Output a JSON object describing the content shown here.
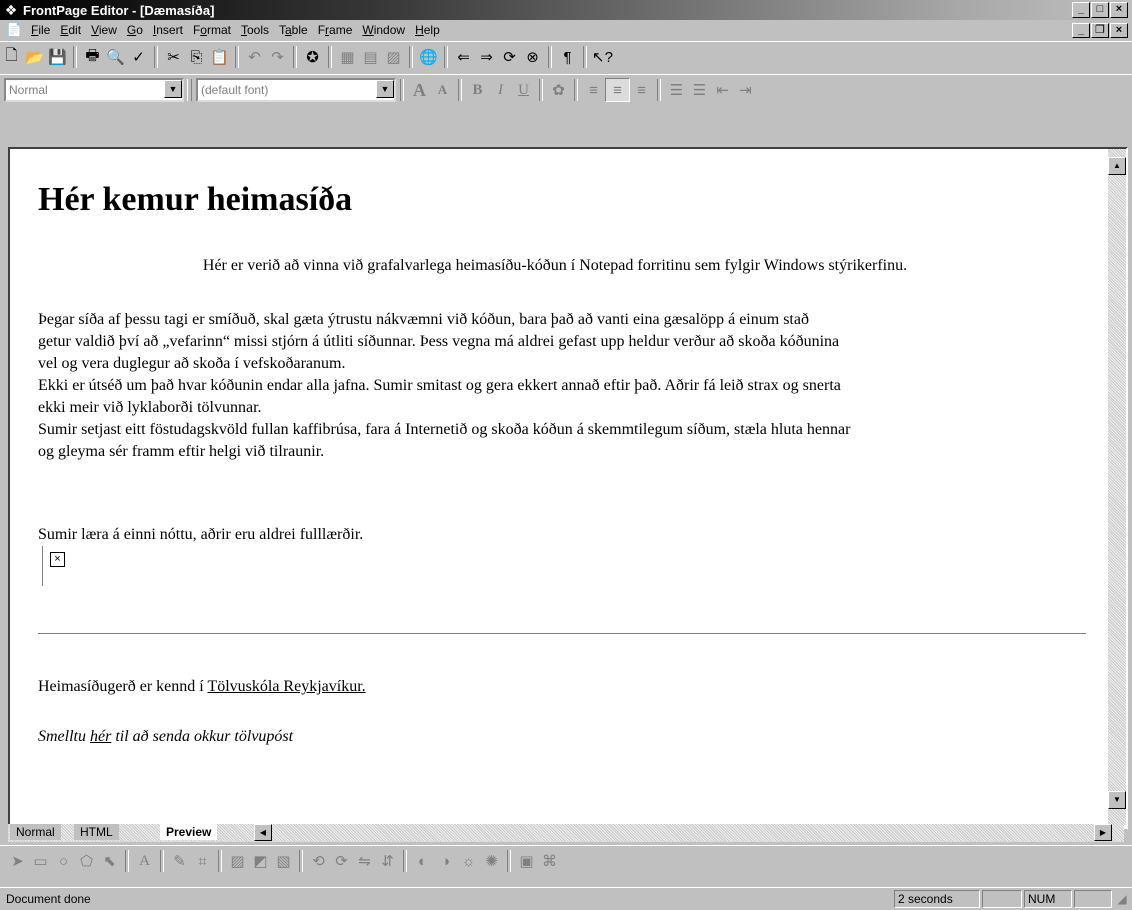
{
  "window": {
    "title": "FrontPage Editor - [Dæmasíða]",
    "controls": {
      "minimize": "_",
      "maximize": "□",
      "close": "×"
    }
  },
  "menu": {
    "items": [
      {
        "pre": "",
        "ul": "F",
        "post": "ile"
      },
      {
        "pre": "",
        "ul": "E",
        "post": "dit"
      },
      {
        "pre": "",
        "ul": "V",
        "post": "iew"
      },
      {
        "pre": "",
        "ul": "G",
        "post": "o"
      },
      {
        "pre": "",
        "ul": "I",
        "post": "nsert"
      },
      {
        "pre": "F",
        "ul": "o",
        "post": "rmat"
      },
      {
        "pre": "",
        "ul": "T",
        "post": "ools"
      },
      {
        "pre": "T",
        "ul": "a",
        "post": "ble"
      },
      {
        "pre": "F",
        "ul": "r",
        "post": "ame"
      },
      {
        "pre": "",
        "ul": "W",
        "post": "indow"
      },
      {
        "pre": "",
        "ul": "H",
        "post": "elp"
      }
    ]
  },
  "format_toolbar": {
    "style_value": "Normal",
    "font_value": "(default font)"
  },
  "document": {
    "heading": "Hér kemur heimasíða",
    "intro": "Hér er verið að vinna við grafalvarlega heimasíðu-kóðun í Notepad forritinu sem fylgir Windows stýrikerfinu.",
    "para1_line1": "Þegar síða af þessu tagi er smíðuð, skal gæta ýtrustu nákvæmni við kóðun, bara það að vanti eina gæsalöpp á einum stað",
    "para1_line2": "getur valdið því að „vefarinn“ missi stjórn á útliti síðunnar. Þess vegna má aldrei gefast upp heldur verður að skoða kóðunina",
    "para1_line3": "vel og vera duglegur að skoða í vefskoðaranum.",
    "para2_line1": "Ekki er útséð um það hvar kóðunin endar alla jafna. Sumir smitast og gera ekkert annað eftir það. Aðrir fá leið strax og snerta",
    "para2_line2": "ekki meir við lyklaborði tölvunnar.",
    "para3_line1": "Sumir setjast eitt föstudagskvöld fullan kaffibrúsa, fara á Internetið og skoða kóðun á skemmtilegum síðum, stæla hluta hennar",
    "para3_line2": "og gleyma sér framm eftir helgi við tilraunir.",
    "para4": "Sumir læra á einni nóttu, aðrir eru aldrei fulllærðir.",
    "footer_prefix": "Heimasíðugerð er kennd í ",
    "footer_link": "Tölvuskóla Reykjavíkur.",
    "mail_prefix": "Smelltu ",
    "mail_link": "hér",
    "mail_suffix": " til að senda okkur tölvupóst"
  },
  "tabs": {
    "normal": "Normal",
    "html": "HTML",
    "preview": "Preview"
  },
  "status": {
    "text": "Document done",
    "time": "2 seconds",
    "num": "NUM"
  }
}
